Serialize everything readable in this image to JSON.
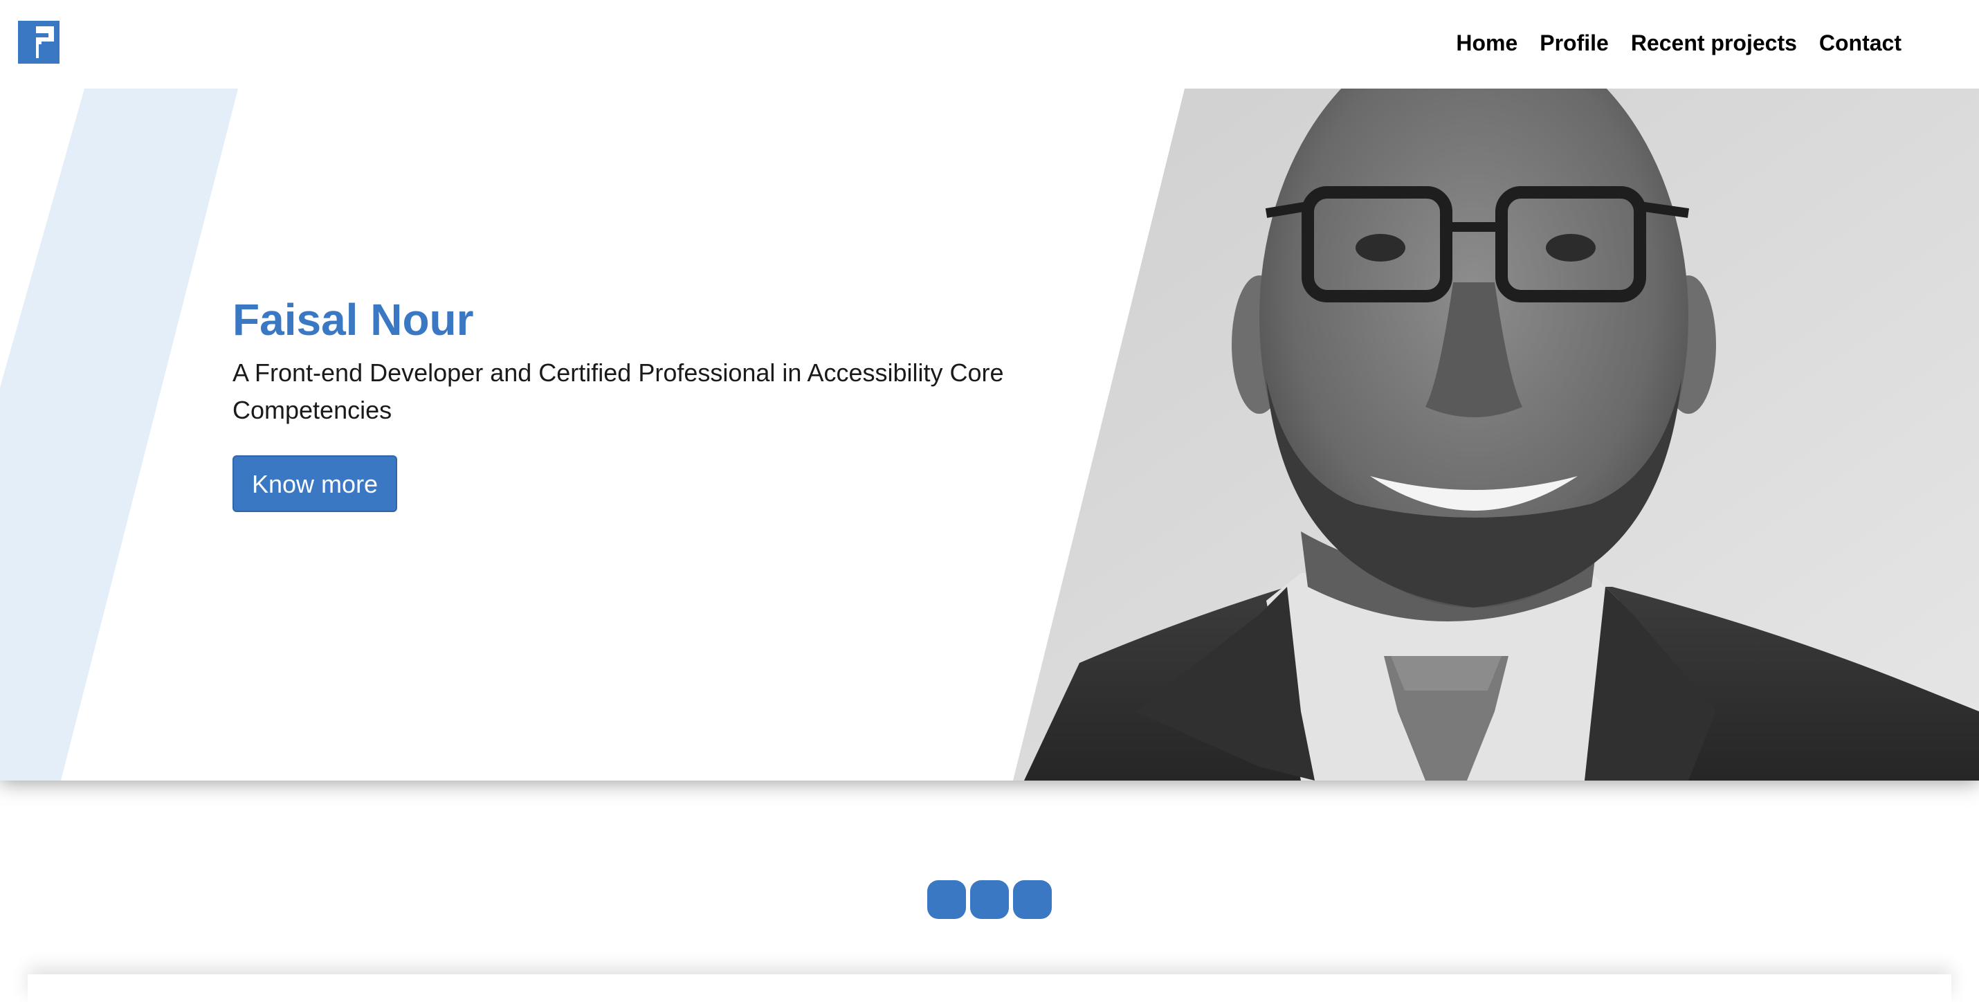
{
  "header": {
    "logo_icon": "fn-monogram-logo",
    "nav": [
      {
        "label": "Home"
      },
      {
        "label": "Profile"
      },
      {
        "label": "Recent projects"
      },
      {
        "label": "Contact"
      }
    ]
  },
  "hero": {
    "title": "Faisal Nour",
    "subtitle": "A Front-end Developer and Certified Professional in Accessibility Core Competencies",
    "button_label": "Know more",
    "photo": "portrait-photo"
  },
  "slider": {
    "dot_count": 3
  },
  "colors": {
    "accent": "#3b78c3",
    "stripe": "#e4eef8",
    "text": "#1a1a1a"
  }
}
